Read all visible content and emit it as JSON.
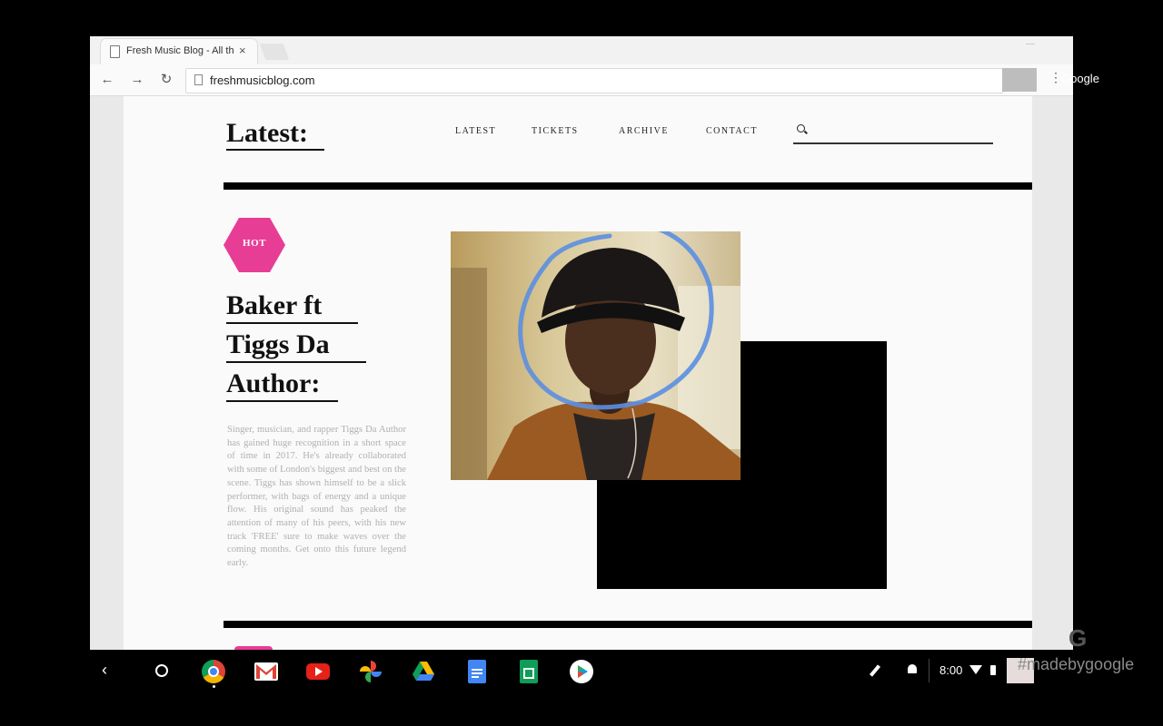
{
  "browser": {
    "tab_title": "Fresh Music Blog - All th",
    "tab_close": "×",
    "url": "freshmusicblog.com",
    "back": "←",
    "forward": "→",
    "reload": "↻",
    "menu": "⋮",
    "profile_label": "Google"
  },
  "site": {
    "logo": "Latest:",
    "nav": [
      "LATEST",
      "TICKETS",
      "ARCHIVE",
      "CONTACT"
    ],
    "search_placeholder": ""
  },
  "article": {
    "badge": "HOT",
    "headline_lines": [
      "Baker ft",
      "Tiggs Da",
      "Author:"
    ],
    "body": "Singer, musician, and rapper Tiggs Da Author has gained huge recognition in a short space of time in 2017. He's already collaborated with some of London's biggest and best on the scene. Tiggs has shown himself to be a slick performer, with bags of energy and a unique flow. His original sound has peaked the attention of many of his peers, with his new track 'FREE' sure to make waves over the coming months. Get onto this future legend early.",
    "image": "portrait-photo"
  },
  "colors": {
    "accent_pink": "#e83d95",
    "annotation_blue": "#5b8fe0",
    "rule": "#000000"
  },
  "shelf": {
    "time": "8:00",
    "watermark": "#madebygoogle",
    "watermark_logo": "G",
    "apps": [
      "chrome-icon",
      "gmail-icon",
      "youtube-icon",
      "photos-icon",
      "drive-icon",
      "docs-icon",
      "sheets-icon",
      "play-store-icon"
    ]
  }
}
